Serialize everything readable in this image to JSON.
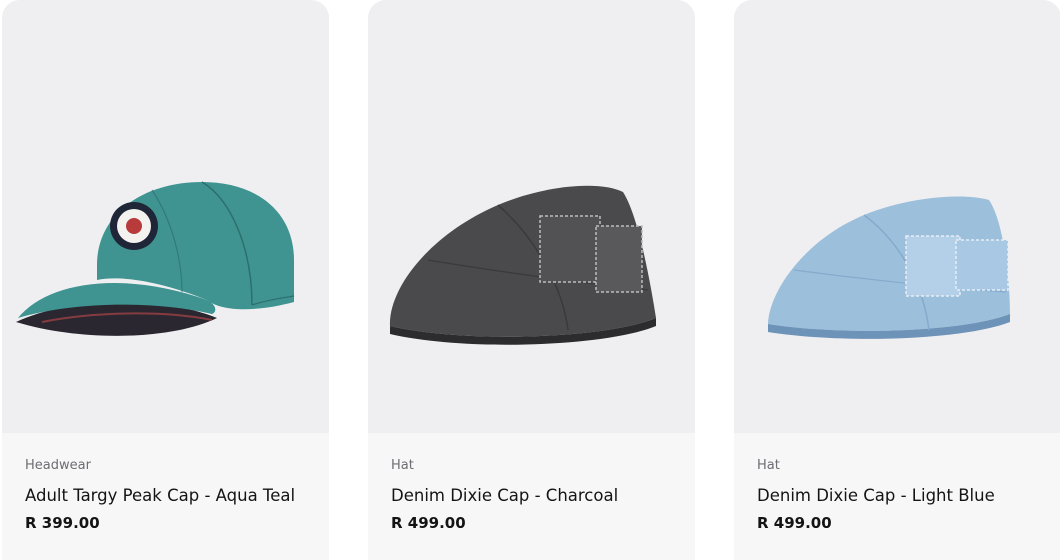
{
  "products": [
    {
      "category": "Headwear",
      "title": "Adult Targy Peak Cap - Aqua Teal",
      "price": "R 399.00",
      "image_icon": "aqua-teal-baseball-cap",
      "colors": {
        "main": "#3f9491",
        "dark": "#2c6f6d"
      }
    },
    {
      "category": "Hat",
      "title": "Denim Dixie Cap - Charcoal",
      "price": "R 499.00",
      "image_icon": "charcoal-denim-flat-cap",
      "colors": {
        "main": "#4a4a4c",
        "dark": "#2c2c2e"
      }
    },
    {
      "category": "Hat",
      "title": "Denim Dixie Cap - Light Blue",
      "price": "R 499.00",
      "image_icon": "light-blue-denim-flat-cap",
      "colors": {
        "main": "#9cbfdc",
        "dark": "#6d93b8"
      }
    }
  ]
}
